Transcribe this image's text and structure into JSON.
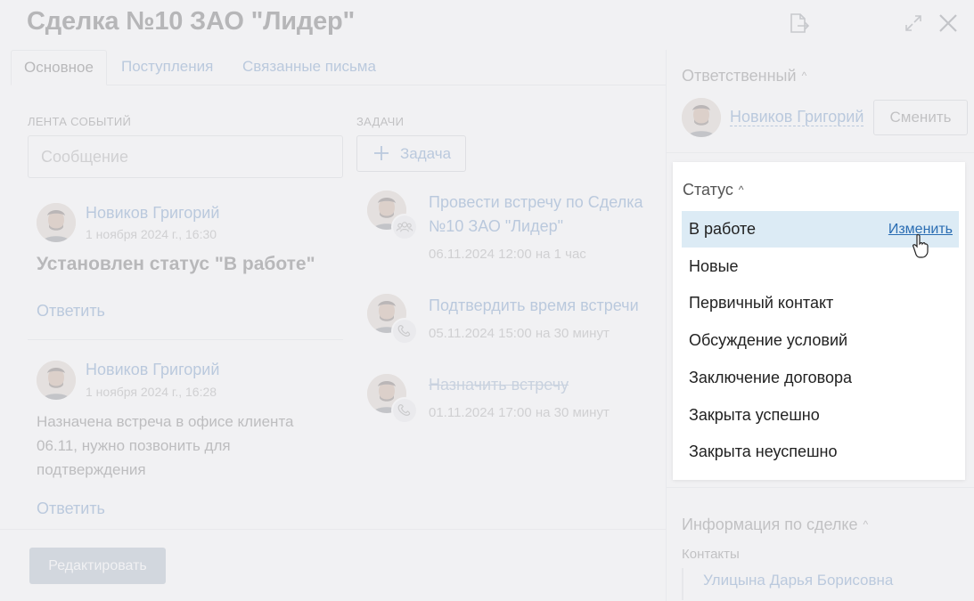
{
  "title": "Сделка №10 ЗАО \"Лидер\"",
  "tabs": [
    "Основное",
    "Поступления",
    "Связанные письма"
  ],
  "feed": {
    "label": "ЛЕНТА СОБЫТИЙ",
    "placeholder": "Сообщение",
    "events": [
      {
        "author": "Новиков Григорий",
        "date": "1 ноября 2024 г., 16:30",
        "title": "Установлен статус \"В работе\"",
        "reply": "Ответить"
      },
      {
        "author": "Новиков Григорий",
        "date": "1 ноября 2024 г., 16:28",
        "text": "Назначена встреча в офисе клиента 06.11, нужно позвонить для подтверждения",
        "reply": "Ответить"
      }
    ]
  },
  "tasks": {
    "label": "ЗАДАЧИ",
    "add_label": "Задача",
    "items": [
      {
        "title": "Провести встречу по Сделка №10 ЗАО \"Лидер\"",
        "meta": "06.11.2024 12:00 на 1 час",
        "badge": "people-icon"
      },
      {
        "title": "Подтвердить время встречи",
        "meta": "05.11.2024 15:00 на 30 минут",
        "badge": "phone-icon"
      },
      {
        "title": "Назначить встречу",
        "meta": "01.11.2024 17:00 на 30 минут",
        "badge": "phone-icon",
        "done": true
      }
    ]
  },
  "footer": {
    "edit_label": "Редактировать"
  },
  "sidebar": {
    "responsible_label": "Ответственный",
    "responsible_name": "Новиков Григорий",
    "change_label": "Сменить",
    "info_label": "Информация по сделке",
    "contacts_label": "Контакты",
    "contact_name": "Улицына Дарья Борисовна"
  },
  "status_popup": {
    "label": "Статус",
    "change_link": "Изменить",
    "selected": "В работе",
    "options": [
      "В работе",
      "Новые",
      "Первичный контакт",
      "Обсуждение условий",
      "Заключение договора",
      "Закрыта успешно",
      "Закрыта неуспешно"
    ]
  },
  "colors": {
    "accent": "#3b6fb0",
    "selected_bg": "#dcebf5",
    "link": "#2a6db3",
    "edit_button": "#8fa0b4"
  }
}
